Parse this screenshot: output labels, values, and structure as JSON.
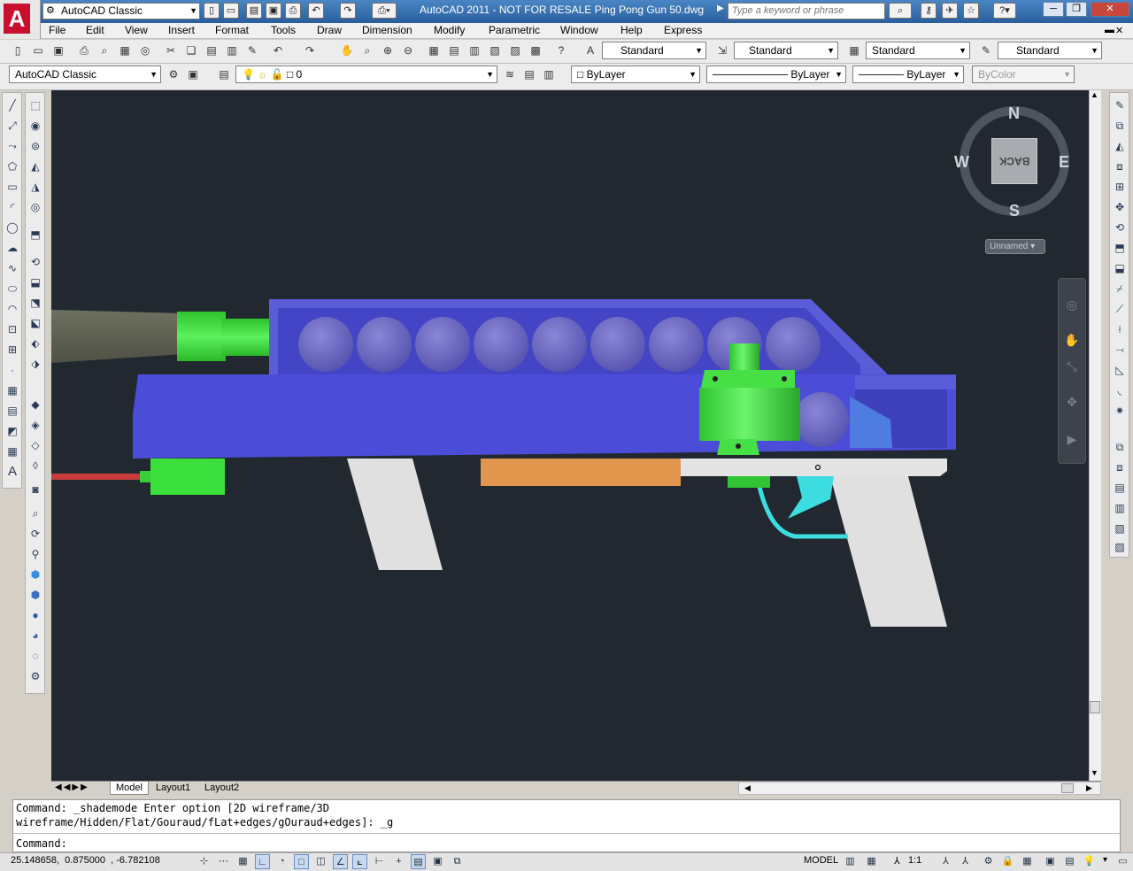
{
  "titlebar": {
    "workspace_combo": "AutoCAD Classic",
    "title": "AutoCAD 2011 - NOT FOR RESALE    Ping Pong Gun 50.dwg",
    "search_placeholder": "Type a keyword or phrase",
    "accent_color": "#2a5e9c"
  },
  "menu": {
    "items": [
      "File",
      "Edit",
      "View",
      "Insert",
      "Format",
      "Tools",
      "Draw",
      "Dimension",
      "Modify",
      "Parametric",
      "Window",
      "Help",
      "Express"
    ]
  },
  "styles_toolbar": {
    "text_style": "Standard",
    "dim_style": "Standard",
    "table_style": "Standard",
    "mleader_style": "Standard"
  },
  "layers_toolbar": {
    "workspace": "AutoCAD Classic",
    "layer": "0",
    "color": "ByLayer",
    "linetype": "ByLayer",
    "lineweight": "ByLayer",
    "plotstyle": "ByColor"
  },
  "viewcube": {
    "north": "N",
    "south": "S",
    "east": "E",
    "west": "W",
    "face": "BACK",
    "ucs": "Unnamed"
  },
  "tabs": [
    "Model",
    "Layout1",
    "Layout2"
  ],
  "active_tab": "Model",
  "command": {
    "history_line1": "Command: _shademode Enter option [2D wireframe/3D",
    "history_line2": "wireframe/Hidden/Flat/Gouraud/fLat+edges/gOuraud+edges]: _g",
    "prompt": "Command:"
  },
  "status": {
    "coordinates": "25.148658,  0.875000  , -6.782108",
    "model_label": "MODEL",
    "scale": "1:1"
  },
  "drawing_colors": {
    "background": "#212830",
    "body": "#4b4dd8",
    "hopper": "#5a5cd6",
    "ball": "#6b66b8",
    "green_part": "#3ce03c",
    "grip": "#e0e0e0",
    "trigger": "#3cdde0",
    "orange_block": "#e2954c",
    "barrel": "#5e6150",
    "laser": "#c83c3c"
  }
}
